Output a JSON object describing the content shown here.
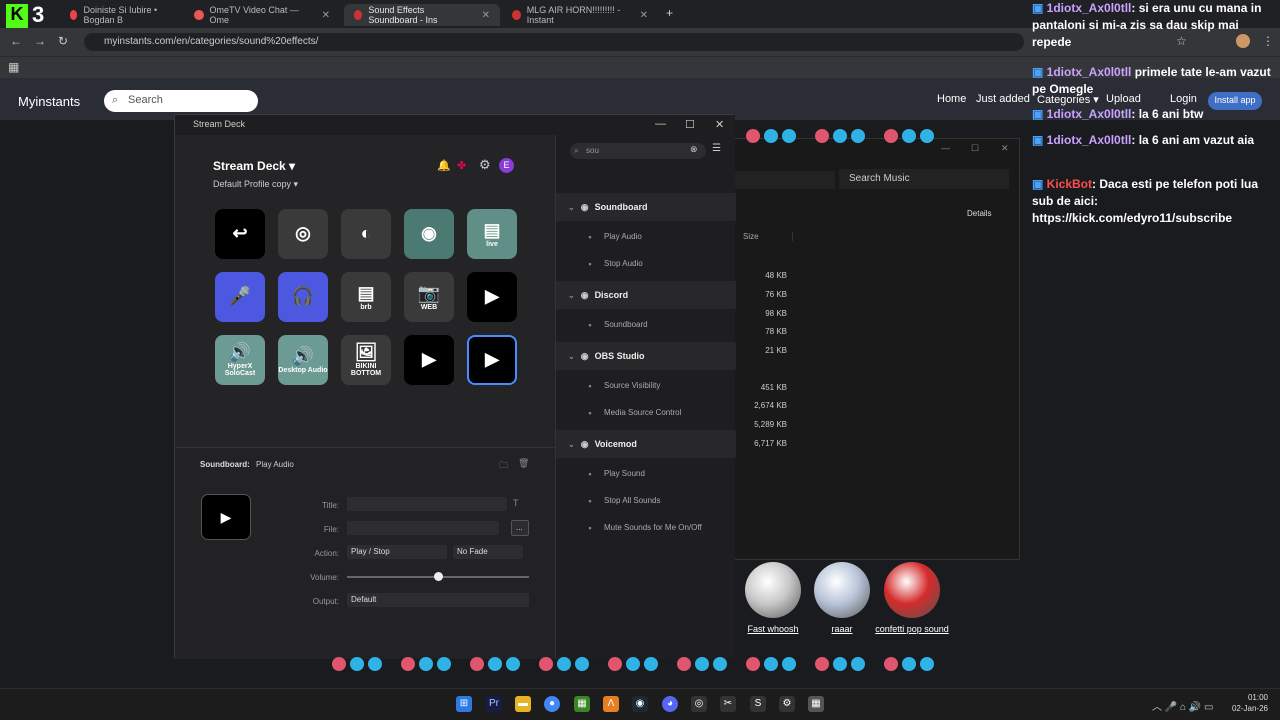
{
  "browser": {
    "tabs": [
      {
        "title": "Doiniste Si Iubire • Bogdan B",
        "active": false
      },
      {
        "title": "OmeTV Video Chat — Ome",
        "active": false
      },
      {
        "title": "Sound Effects Soundboard - Ins",
        "active": true
      },
      {
        "title": "MLG AIR HORN!!!!!!!!! - Instant",
        "active": false
      }
    ],
    "new_tab": "+",
    "url": "myinstants.com/en/categories/sound%20effects/"
  },
  "site": {
    "logo": "Myinstants",
    "search_placeholder": "Search",
    "nav": [
      "Home",
      "Just added",
      "Categories ▾",
      "Upload",
      "Login"
    ],
    "install": "Install app"
  },
  "streamdeck": {
    "window_title": "Stream Deck",
    "app_name": "Stream Deck ▾",
    "profile": "Default Profile copy ▾",
    "avatar_letter": "E",
    "keys": [
      {
        "label": "",
        "icon": "↩"
      },
      {
        "label": "",
        "icon": "◎"
      },
      {
        "label": "",
        "icon": "◐"
      },
      {
        "label": "",
        "icon": "◉"
      },
      {
        "label": "live",
        "icon": "▤"
      },
      {
        "label": "",
        "icon": "🎤"
      },
      {
        "label": "",
        "icon": "🎧"
      },
      {
        "label": "brb",
        "icon": "▤"
      },
      {
        "label": "WEB",
        "icon": "📷"
      },
      {
        "label": "",
        "icon": "▶"
      },
      {
        "label": "HyperX SoloCast",
        "icon": "🔊"
      },
      {
        "label": "Desktop Audio",
        "icon": "🔊"
      },
      {
        "label": "BIKINI BOTTOM",
        "icon": "🖼"
      },
      {
        "label": "",
        "icon": "▶"
      },
      {
        "label": "",
        "icon": "▶"
      }
    ],
    "search_value": "sou",
    "categories": [
      {
        "name": "Soundboard",
        "actions": [
          "Play Audio",
          "Stop Audio"
        ]
      },
      {
        "name": "Discord",
        "actions": [
          "Soundboard"
        ]
      },
      {
        "name": "OBS Studio",
        "actions": [
          "Source Visibility",
          "Media Source Control"
        ]
      },
      {
        "name": "Voicemod",
        "actions": [
          "Play Sound",
          "Stop All Sounds",
          "Mute Sounds for Me On/Off"
        ]
      }
    ],
    "props": {
      "breadcrumb_plugin": "Soundboard:",
      "breadcrumb_action": "Play Audio",
      "title_label": "Title:",
      "file_label": "File:",
      "file_btn": "...",
      "action_label": "Action:",
      "action_value": "Play / Stop",
      "fade_value": "No Fade",
      "volume_label": "Volume:",
      "volume": 0.5,
      "output_label": "Output:",
      "output_value": "Default"
    }
  },
  "explorer": {
    "search": "Search Music",
    "details": "Details",
    "size_header": "Size",
    "sizes": [
      "48 KB",
      "76 KB",
      "98 KB",
      "78 KB",
      "21 KB",
      "",
      "451 KB",
      "2,674 KB",
      "5,289 KB",
      "6,717 KB"
    ]
  },
  "chat": [
    {
      "user": "1diotx_Ax0l0tll",
      "text": ": si era unu cu mana in pantaloni si mi-a zis sa dau skip mai repede"
    },
    {
      "user": "1diotx_Ax0l0tll",
      "text": " primele tate le-am vazut pe Omegle"
    },
    {
      "user": "1diotx_Ax0l0tll",
      "text": ": la 6 ani btw"
    },
    {
      "user": "1diotx_Ax0l0tll",
      "text": ": la 6 ani am vazut aia"
    },
    {
      "user": "KickBot",
      "text": ": Daca esti pe telefon poti lua sub de aici: https://kick.com/edyro11/subscribe"
    }
  ],
  "sounds": [
    {
      "name": "Fast whoosh",
      "color": "#c8c8c8"
    },
    {
      "name": "raaar",
      "color": "#b8c4d8"
    },
    {
      "name": "confetti pop sound",
      "color": "#d42b2b"
    }
  ],
  "taskbar": {
    "time": "01:00",
    "date": "02-Jan-26"
  },
  "overlay": {
    "badge": "3"
  }
}
